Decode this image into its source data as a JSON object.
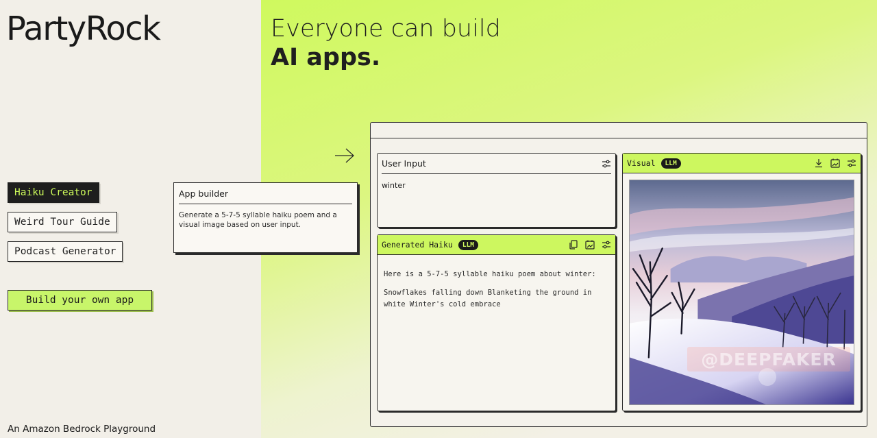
{
  "brand": {
    "logo": "PartyRock",
    "footer": "An Amazon Bedrock Playground"
  },
  "hero": {
    "line1": "Everyone can build",
    "line2": "AI apps."
  },
  "apps": [
    {
      "label": "Haiku Creator",
      "active": true
    },
    {
      "label": "Weird Tour Guide",
      "active": false
    },
    {
      "label": "Podcast Generator",
      "active": false
    }
  ],
  "build_button": "Build your own app",
  "builder": {
    "title": "App builder",
    "description": "Generate a 5-7-5 syllable haiku poem and a visual image based on user input."
  },
  "widgets": {
    "user_input": {
      "title": "User Input",
      "value": "winter",
      "icon": "sliders-icon"
    },
    "haiku": {
      "title": "Generated Haiku",
      "badge": "LLM",
      "intro": "Here is a 5-7-5 syllable haiku poem about winter:",
      "poem": "Snowflakes falling down Blanketing the ground in white Winter's cold embrace",
      "icons": [
        "copy-icon",
        "image-icon",
        "sliders-icon"
      ]
    },
    "visual": {
      "title": "Visual",
      "badge": "LLM",
      "icons": [
        "download-icon",
        "image-icon",
        "sliders-icon"
      ],
      "image_desc": "Winter landscape painting with bare trees, snowy hills and purple mountains"
    }
  },
  "watermark": "@DEEPFAKER",
  "colors": {
    "accent": "#cdf75f",
    "dark": "#1a1a1a",
    "background": "#f2efe8"
  }
}
